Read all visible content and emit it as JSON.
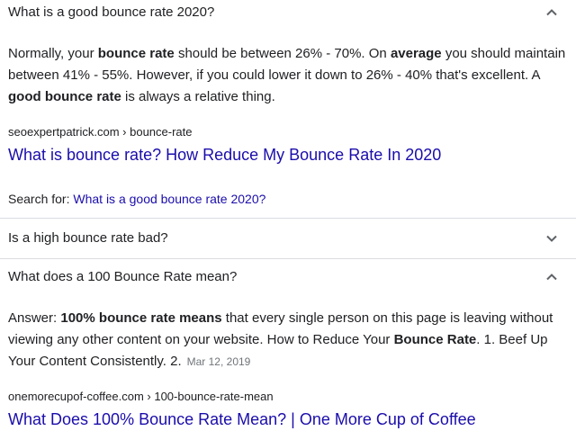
{
  "faq": [
    {
      "question": "What is a good bounce rate 2020?",
      "expanded": true,
      "answer_parts": {
        "p1": "Normally, your ",
        "b1": "bounce rate",
        "p2": " should be between 26% - 70%. On ",
        "b2": "average",
        "p3": " you should maintain between 41% - 55%. However, if you could lower it down to 26% - 40% that's excellent. A ",
        "b3": "good bounce rate",
        "p4": " is always a relative thing."
      },
      "source": {
        "cite": "seoexpertpatrick.com › bounce-rate",
        "title": "What is bounce rate? How Reduce My Bounce Rate In 2020"
      },
      "search_for": {
        "label": "Search for: ",
        "link": "What is a good bounce rate 2020?"
      }
    },
    {
      "question": "Is a high bounce rate bad?",
      "expanded": false
    },
    {
      "question": "What does a 100 Bounce Rate mean?",
      "expanded": true,
      "answer_parts": {
        "p1": "Answer: ",
        "b1": "100%",
        "p2": " ",
        "b2": "bounce rate means",
        "p3": " that every single person on this page is leaving without viewing any other content on your website. How to Reduce Your ",
        "b3": "Bounce Rate",
        "p4": ". 1. Beef Up Your Content Consistently. 2."
      },
      "date": "Mar 12, 2019",
      "source": {
        "cite": "onemorecupof-coffee.com › 100-bounce-rate-mean",
        "title": "What Does 100% Bounce Rate Mean? | One More Cup of Coffee"
      }
    }
  ],
  "icons": {
    "expanded": "chevron-up-icon",
    "collapsed": "chevron-down-icon"
  },
  "colors": {
    "link": "#1a0dab",
    "text": "#202124",
    "muted": "#70757a",
    "divider": "#dadce0"
  }
}
